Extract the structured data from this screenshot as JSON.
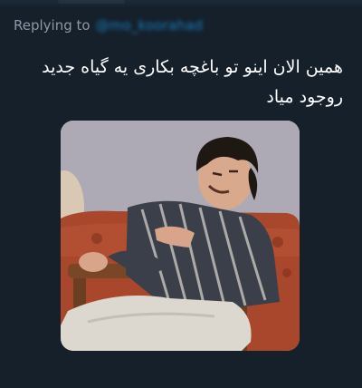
{
  "reply": {
    "label": "Replying to",
    "handle": "@mo_koorahad"
  },
  "tweet": {
    "line1": "همین الان اینو تو باغچه بکاری یه گیاه جدید",
    "line2": "روجود میاد"
  },
  "media": {
    "icon": "photo",
    "colors": {
      "wall": "#a3a1ad",
      "sofa": "#a8472c",
      "shirt_dark": "#3a3f4a",
      "trousers": "#ddd8cf",
      "hair": "#1e1712"
    }
  }
}
